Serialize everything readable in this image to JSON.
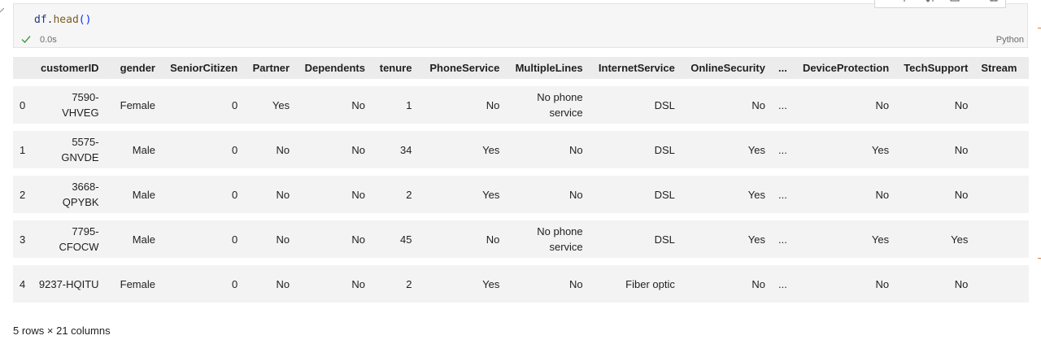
{
  "cell": {
    "code_var": "df",
    "code_dot": ".",
    "code_fn": "head",
    "code_parens": "()",
    "exec_status_icon": "check-icon",
    "exec_time": "0.0s",
    "language": "Python",
    "status_color": "#3c9a3c"
  },
  "table": {
    "columns": [
      "",
      "customerID",
      "gender",
      "SeniorCitizen",
      "Partner",
      "Dependents",
      "tenure",
      "PhoneService",
      "MultipleLines",
      "InternetService",
      "OnlineSecurity",
      "...",
      "DeviceProtection",
      "TechSupport",
      "Stream"
    ],
    "rows": [
      [
        "0",
        "7590-VHVEG",
        "Female",
        "0",
        "Yes",
        "No",
        "1",
        "No",
        "No phone service",
        "DSL",
        "No",
        "...",
        "No",
        "No",
        ""
      ],
      [
        "1",
        "5575-GNVDE",
        "Male",
        "0",
        "No",
        "No",
        "34",
        "Yes",
        "No",
        "DSL",
        "Yes",
        "...",
        "Yes",
        "No",
        ""
      ],
      [
        "2",
        "3668-QPYBK",
        "Male",
        "0",
        "No",
        "No",
        "2",
        "Yes",
        "No",
        "DSL",
        "Yes",
        "...",
        "No",
        "No",
        ""
      ],
      [
        "3",
        "7795-CFOCW",
        "Male",
        "0",
        "No",
        "No",
        "45",
        "No",
        "No phone service",
        "DSL",
        "Yes",
        "...",
        "Yes",
        "Yes",
        ""
      ],
      [
        "4",
        "9237-HQITU",
        "Female",
        "0",
        "No",
        "No",
        "2",
        "Yes",
        "No",
        "Fiber optic",
        "No",
        "...",
        "No",
        "No",
        ""
      ]
    ]
  },
  "shape_note": "5 rows × 21 columns"
}
